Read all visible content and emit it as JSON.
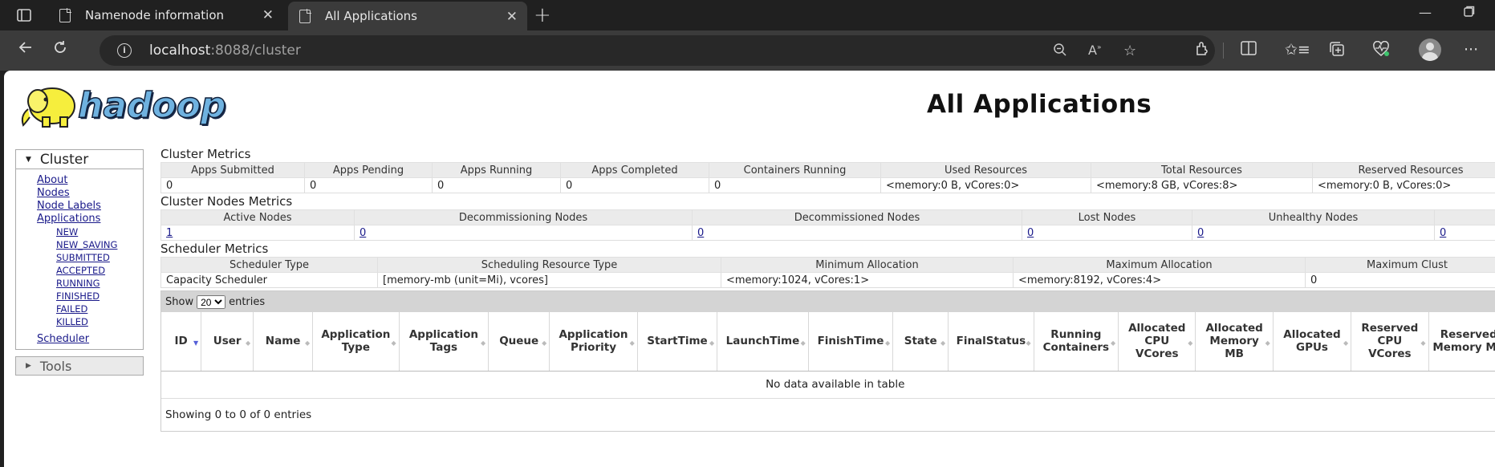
{
  "browser": {
    "tabs": [
      {
        "title": "Namenode information"
      },
      {
        "title": "All Applications"
      }
    ],
    "url_host": "localhost",
    "url_rest": ":8088/cluster"
  },
  "page": {
    "title": "All Applications",
    "logo_text": "hadoop"
  },
  "sidebar": {
    "cluster_label": "Cluster",
    "links": [
      "About",
      "Nodes",
      "Node Labels",
      "Applications"
    ],
    "app_states": [
      "NEW",
      "NEW_SAVING",
      "SUBMITTED",
      "ACCEPTED",
      "RUNNING",
      "FINISHED",
      "FAILED",
      "KILLED"
    ],
    "scheduler_label": "Scheduler",
    "tools_label": "Tools"
  },
  "cluster_metrics": {
    "title": "Cluster Metrics",
    "headers": [
      "Apps Submitted",
      "Apps Pending",
      "Apps Running",
      "Apps Completed",
      "Containers Running",
      "Used Resources",
      "Total Resources",
      "Reserved Resources"
    ],
    "values": [
      "0",
      "0",
      "0",
      "0",
      "0",
      "<memory:0 B, vCores:0>",
      "<memory:8 GB, vCores:8>",
      "<memory:0 B, vCores:0>"
    ]
  },
  "nodes_metrics": {
    "title": "Cluster Nodes Metrics",
    "headers": [
      "Active Nodes",
      "Decommissioning Nodes",
      "Decommissioned Nodes",
      "Lost Nodes",
      "Unhealthy Nodes",
      ""
    ],
    "values": [
      "1",
      "0",
      "0",
      "0",
      "0",
      "0"
    ]
  },
  "scheduler_metrics": {
    "title": "Scheduler Metrics",
    "headers": [
      "Scheduler Type",
      "Scheduling Resource Type",
      "Minimum Allocation",
      "Maximum Allocation",
      "Maximum Clust"
    ],
    "values": [
      "Capacity Scheduler",
      "[memory-mb (unit=Mi), vcores]",
      "<memory:1024, vCores:1>",
      "<memory:8192, vCores:4>",
      "0"
    ]
  },
  "apps_table": {
    "show_label": "Show",
    "entries_label": "entries",
    "page_size": "20",
    "columns": [
      "ID",
      "User",
      "Name",
      "Application Type",
      "Application Tags",
      "Queue",
      "Application Priority",
      "StartTime",
      "LaunchTime",
      "FinishTime",
      "State",
      "FinalStatus",
      "Running Containers",
      "Allocated CPU VCores",
      "Allocated Memory MB",
      "Allocated GPUs",
      "Reserved CPU VCores",
      "Reserved Memory MB"
    ],
    "empty_text": "No data available in table",
    "footer": "Showing 0 to 0 of 0 entries"
  }
}
